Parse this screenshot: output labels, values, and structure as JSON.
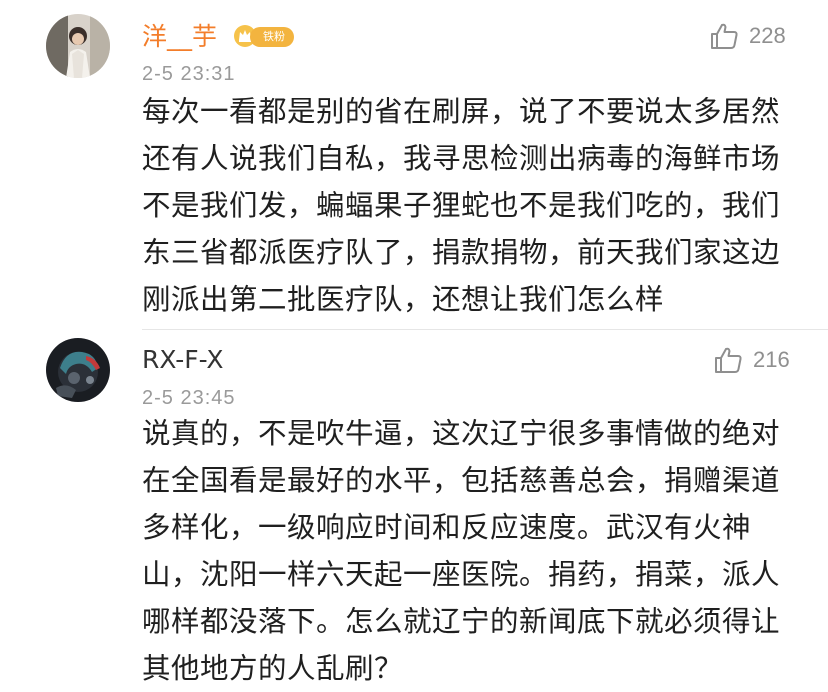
{
  "comments": [
    {
      "username": "洋__芋",
      "badge": {
        "label": "铁粉"
      },
      "time": "2-5 23:31",
      "likes": "228",
      "text": "每次一看都是别的省在刷屏，说了不要说太多居然\n还有人说我们自私，我寻思检测出病毒的海鲜市场\n不是我们发，蝙蝠果子狸蛇也不是我们吃的，我们\n东三省都派医疗队了，捐款捐物，前天我们家这边\n刚派出第二批医疗队，还想让我们怎么样"
    },
    {
      "username": "RX-F-X",
      "time": "2-5 23:45",
      "likes": "216",
      "text": "说真的，不是吹牛逼，这次辽宁很多事情做的绝对\n在全国看是最好的水平，包括慈善总会，捐赠渠道\n多样化，一级响应时间和反应速度。武汉有火神\n山，沈阳一样六天起一座医院。捐药，捐菜，派人\n哪样都没落下。怎么就辽宁的新闻底下就必须得让\n其他地方的人乱刷？"
    }
  ],
  "colors": {
    "vip_username": "#f37d2a",
    "normal_username": "#333333",
    "meta_gray": "#9a9a9a",
    "badge_gold": "#f3b43f"
  },
  "icons": {
    "like": "thumbs-up-outline-icon",
    "badge": "crown-fan-badge-icon"
  }
}
